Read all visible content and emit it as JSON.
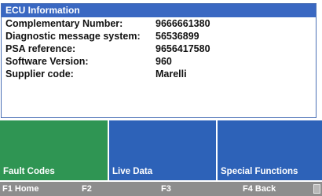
{
  "info_panel": {
    "title": "ECU Information",
    "rows": [
      {
        "label": "Complementary Number:",
        "value": "9666661380"
      },
      {
        "label": "Diagnostic message system:",
        "value": "56536899"
      },
      {
        "label": "PSA reference:",
        "value": "9656417580"
      },
      {
        "label": "Software Version:",
        "value": "960"
      },
      {
        "label": "Supplier code:",
        "value": "Marelli"
      }
    ]
  },
  "softkeys": [
    {
      "label": "Fault Codes",
      "color": "#2f9553"
    },
    {
      "label": "Live Data",
      "color": "#2d62b8"
    },
    {
      "label": "Special Functions",
      "color": "#2d62b8"
    }
  ],
  "function_keys": [
    {
      "label": "F1 Home"
    },
    {
      "label": "F2"
    },
    {
      "label": "F3"
    },
    {
      "label": "F4 Back"
    }
  ],
  "icons": {
    "scroll": "scroll-indicator-icon"
  },
  "colors": {
    "title_bar": "#3a68c2",
    "fkey_bar": "#8d8d8d"
  }
}
